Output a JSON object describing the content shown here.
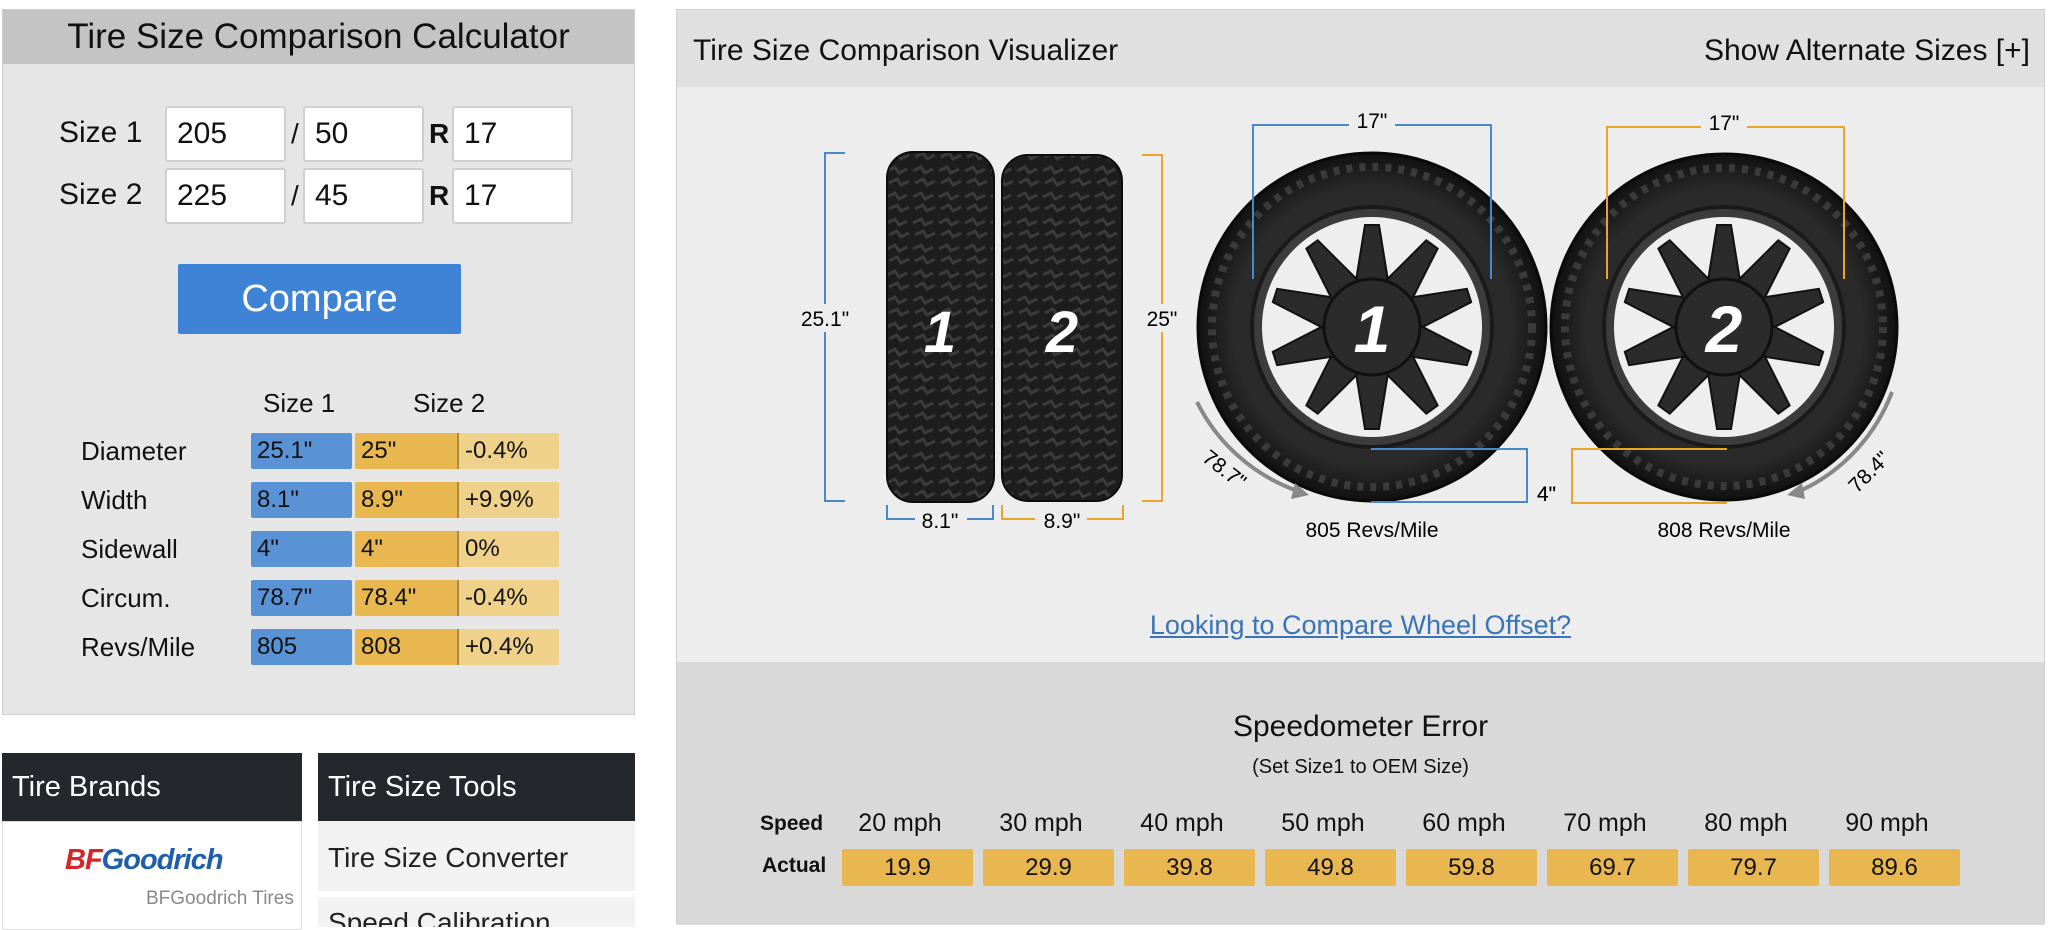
{
  "calculator": {
    "title": "Tire Size Comparison Calculator",
    "size1": {
      "label": "Size 1",
      "width": "205",
      "aspect": "50",
      "rim_sep": "R",
      "rim": "17"
    },
    "size2": {
      "label": "Size 2",
      "width": "225",
      "aspect": "45",
      "rim_sep": "R",
      "rim": "17"
    },
    "slash": "/",
    "compare_label": "Compare",
    "results": {
      "col1": "Size 1",
      "col2": "Size 2",
      "rows": [
        {
          "label": "Diameter",
          "s1": "25.1\"",
          "s2": "25\"",
          "diff": "-0.4%"
        },
        {
          "label": "Width",
          "s1": "8.1\"",
          "s2": "8.9\"",
          "diff": "+9.9%"
        },
        {
          "label": "Sidewall",
          "s1": "4\"",
          "s2": "4\"",
          "diff": "0%"
        },
        {
          "label": "Circum.",
          "s1": "78.7\"",
          "s2": "78.4\"",
          "diff": "-0.4%"
        },
        {
          "label": "Revs/Mile",
          "s1": "805",
          "s2": "808",
          "diff": "+0.4%"
        }
      ]
    }
  },
  "brands": {
    "title": "Tire Brands",
    "logo_bf": "BF",
    "logo_goodrich": "Goodrich",
    "logo_caption": "BFGoodrich Tires"
  },
  "tools": {
    "title": "Tire Size Tools",
    "items": [
      "Tire Size Converter",
      "Speed Calibration"
    ]
  },
  "visualizer": {
    "title": "Tire Size Comparison Visualizer",
    "alt_sizes": "Show Alternate Sizes [+]",
    "tire1_num": "1",
    "tire2_num": "2",
    "dim1_height": "25.1\"",
    "dim2_height": "25\"",
    "dim1_width": "8.1\"",
    "dim2_width": "8.9\"",
    "wheel1_rim": "17\"",
    "wheel2_rim": "17\"",
    "wheel1_sidewall": "4\"",
    "wheel2_sidewall": "4\"",
    "wheel1_circ": "78.7\"",
    "wheel2_circ": "78.4\"",
    "wheel1_revs": "805 Revs/Mile",
    "wheel2_revs": "808 Revs/Mile",
    "offset_link": "Looking to Compare Wheel Offset?",
    "colors": {
      "size1": "#4a88cc",
      "size2": "#e6a62a"
    }
  },
  "speedometer": {
    "title": "Speedometer Error",
    "subtitle": "(Set Size1 to OEM Size)",
    "speed_label": "Speed",
    "actual_label": "Actual",
    "speeds": [
      "20 mph",
      "30 mph",
      "40 mph",
      "50 mph",
      "60 mph",
      "70 mph",
      "80 mph",
      "90 mph"
    ],
    "actual": [
      "19.9",
      "29.9",
      "39.8",
      "49.8",
      "59.8",
      "69.7",
      "79.7",
      "89.6"
    ]
  }
}
